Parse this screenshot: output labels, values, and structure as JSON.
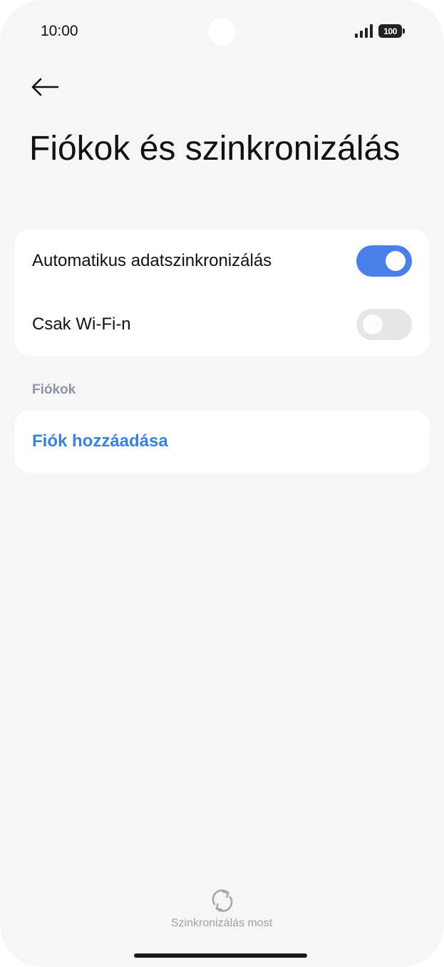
{
  "status_bar": {
    "time": "10:00",
    "battery": "100",
    "icons": [
      "signal-icon",
      "battery-icon"
    ]
  },
  "header": {
    "back_icon": "arrow-left-icon",
    "title": "Fiókok és szinkronizálás"
  },
  "sync_settings": {
    "auto_sync": {
      "label": "Automatikus adatszinkronizálás",
      "enabled": true
    },
    "wifi_only": {
      "label": "Csak Wi-Fi-n",
      "enabled": false
    }
  },
  "accounts": {
    "section_title": "Fiókok",
    "add_account_label": "Fiók hozzáadása"
  },
  "footer": {
    "sync_now_label": "Szinkronizálás most",
    "sync_icon": "refresh-icon"
  },
  "colors": {
    "accent": "#4a7fe8",
    "link": "#3a80df",
    "background": "#f6f6f6",
    "section_header": "#8f93a8"
  }
}
